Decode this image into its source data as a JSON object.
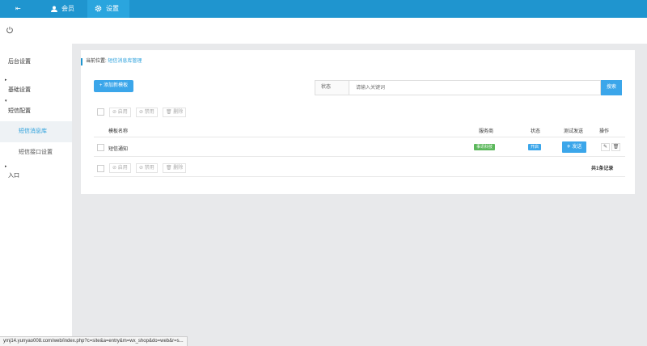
{
  "topbar": {
    "menu_icon": "⇤",
    "member_label": "会员",
    "settings_label": "设置"
  },
  "sidebar": {
    "group1": "后台设置",
    "group2": "基础设置",
    "group3": "短信配置",
    "sub_active": "短信消息库",
    "sub2": "短信接口设置",
    "group4": "入口"
  },
  "breadcrumb": {
    "prefix": "当前位置:",
    "current": "短信消息库管理"
  },
  "toolbar": {
    "add_label": "+ 添加新模板",
    "status_label": "状态",
    "search_placeholder": "请输入关键词",
    "search_button": "搜索"
  },
  "bulk": {
    "enable": "⊘ 启用",
    "disable": "⊘ 禁用",
    "delete": "🗑 删除"
  },
  "table": {
    "headers": {
      "name": "模板名称",
      "provider": "服务商",
      "status": "状态",
      "test_send": "测试发送",
      "action": "操作"
    },
    "rows": [
      {
        "name": "短信通知",
        "provider": "事讯科技",
        "status": "开启",
        "send_label": "✈ 发送"
      }
    ]
  },
  "total_text": "共1条记录",
  "status_url": "ymj14.yunyao008.com/web/index.php?c=site&a=entry&m=wx_shop&do=web&r=s...",
  "colors": {
    "topbar": "#1f95cf",
    "accent": "#3ba6ea",
    "green": "#5cb85c"
  }
}
